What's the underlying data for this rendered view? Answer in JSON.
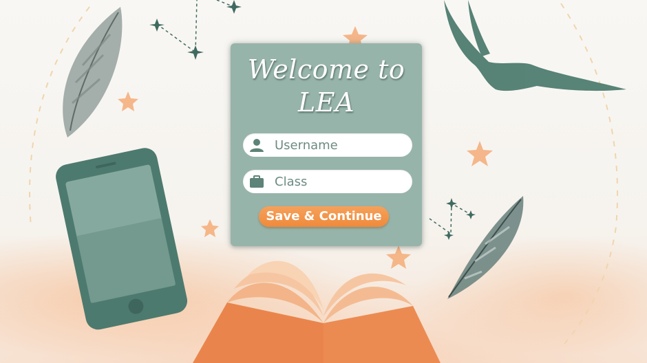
{
  "login_card": {
    "title": "Welcome to\nLEA",
    "username": {
      "placeholder": "Username",
      "value": "",
      "icon": "user-icon"
    },
    "class": {
      "placeholder": "Class",
      "value": "",
      "icon": "briefcase-icon"
    },
    "save_button_label": "Save & Continue"
  },
  "colors": {
    "card_background": "#97b4aa",
    "accent_orange": "#f19245",
    "icon_green": "#5e8379",
    "illustration_green": "#4f7c70",
    "illustration_orange": "#f2a36b"
  }
}
